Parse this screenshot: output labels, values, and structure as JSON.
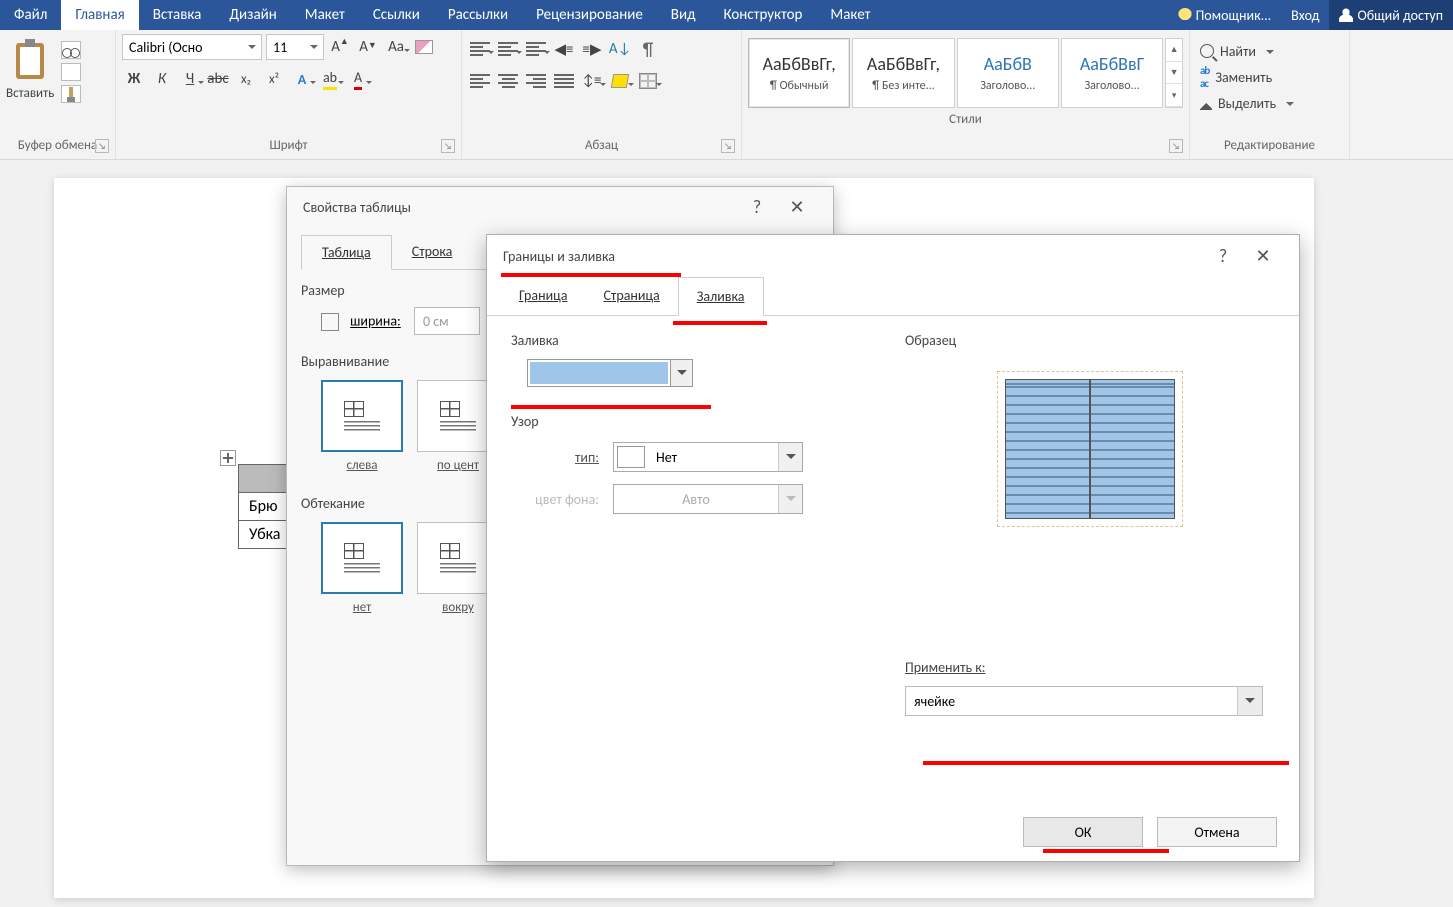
{
  "tabs": {
    "file": "Файл",
    "home": "Главная",
    "insert": "Вставка",
    "design": "Дизайн",
    "layout": "Макет",
    "refs": "Ссылки",
    "mail": "Рассылки",
    "review": "Рецензирование",
    "view": "Вид",
    "ctor": "Конструктор",
    "layout2": "Макет",
    "tell": "Помощник...",
    "signin": "Вход",
    "share": "Общий доступ"
  },
  "ribbon": {
    "clipboard": {
      "paste": "Вставить",
      "label": "Буфер обмена"
    },
    "font": {
      "name": "Calibri (Осно",
      "size": "11",
      "b": "Ж",
      "i": "К",
      "u": "Ч",
      "strike": "abc",
      "sub": "x₂",
      "sup": "x²",
      "label": "Шрифт"
    },
    "para": {
      "label": "Абзац"
    },
    "styles": {
      "label": "Стили",
      "preview": "АаБбВвГг,",
      "preview_blue": "АаБбВ",
      "preview_blue2": "АаБбВвГ",
      "s1": "¶ Обычный",
      "s2": "¶ Без инте...",
      "s3": "Заголово...",
      "s4": "Заголово..."
    },
    "edit": {
      "find": "Найти",
      "replace": "Заменить",
      "select": "Выделить",
      "label": "Редактирование"
    }
  },
  "doc": {
    "cell1": "Брю",
    "cell2": "Убка"
  },
  "dlg1": {
    "title": "Свойства таблицы",
    "help": "?",
    "tab_table": "Таблица",
    "tab_row": "Строка",
    "size": "Размер",
    "width": "ширина:",
    "width_val": "0 см",
    "align": "Выравнивание",
    "a1": "слева",
    "a2": "по цент",
    "wrap": "Обтекание",
    "w1": "нет",
    "w2": "вокру"
  },
  "dlg2": {
    "title": "Границы и заливка",
    "help": "?",
    "tab1": "Граница",
    "tab2": "Страница",
    "tab3": "Заливка",
    "fill": "Заливка",
    "pattern": "Узор",
    "type": "тип:",
    "type_val": "Нет",
    "bgcolor": "цвет фона:",
    "bg_val": "Авто",
    "sample": "Образец",
    "apply": "Применить к:",
    "apply_val": "ячейке",
    "ok": "ОК",
    "cancel": "Отмена"
  }
}
